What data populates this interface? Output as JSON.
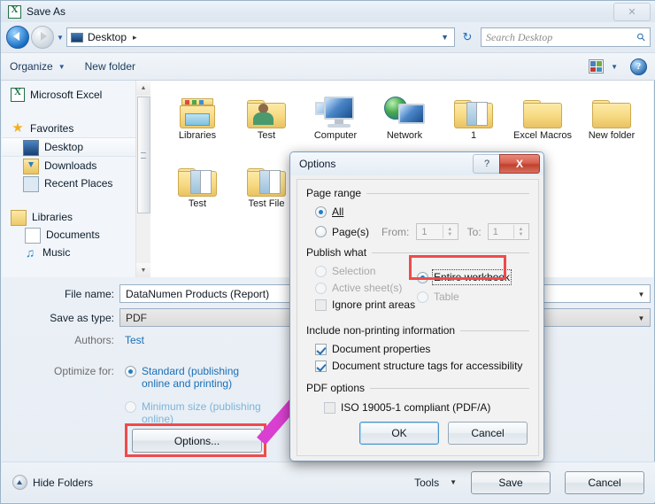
{
  "window": {
    "title": "Save As",
    "app_icon": "excel-icon",
    "close_label": "✕"
  },
  "address_bar": {
    "back_icon": "back-arrow-icon",
    "forward_icon": "forward-arrow-icon",
    "history_icon": "chevron-down-icon",
    "location_icon": "desktop-icon",
    "location": "Desktop",
    "separator": "▸",
    "dropdown_icon": "chevron-down-icon",
    "refresh_icon": "refresh-icon",
    "search_placeholder": "Search Desktop",
    "search_value": "",
    "search_icon": "magnifier-icon"
  },
  "command_bar": {
    "organize": "Organize",
    "new_folder": "New folder",
    "view_icon": "view-layout-icon",
    "view_dropdown_icon": "chevron-down-icon",
    "help_icon": "help-icon",
    "help_label": "?"
  },
  "nav_pane": {
    "items": [
      {
        "label": "Microsoft Excel",
        "icon": "excel-icon",
        "level": 1,
        "selected": false
      },
      {
        "label": "Favorites",
        "icon": "star-icon",
        "level": 1,
        "selected": false
      },
      {
        "label": "Desktop",
        "icon": "desktop-icon",
        "level": 2,
        "selected": true
      },
      {
        "label": "Downloads",
        "icon": "downloads-folder-icon",
        "level": 2,
        "selected": false
      },
      {
        "label": "Recent Places",
        "icon": "recent-places-icon",
        "level": 2,
        "selected": false
      },
      {
        "label": "Libraries",
        "icon": "libraries-icon",
        "level": 1,
        "selected": false
      },
      {
        "label": "Documents",
        "icon": "document-icon",
        "level": 2,
        "selected": false
      },
      {
        "label": "Music",
        "icon": "music-note-icon",
        "level": 2,
        "selected": false
      }
    ],
    "scroll_up_icon": "scroll-up-icon",
    "scroll_down_icon": "scroll-down-icon"
  },
  "file_pane": {
    "items": [
      {
        "label": "Libraries",
        "icon": "libraries-icon"
      },
      {
        "label": "Test",
        "icon": "user-folder-icon"
      },
      {
        "label": "Computer",
        "icon": "computer-icon"
      },
      {
        "label": "Network",
        "icon": "network-icon"
      },
      {
        "label": "1",
        "icon": "folder-with-files-icon"
      },
      {
        "label": "Excel Macros",
        "icon": "folder-icon"
      },
      {
        "label": "New folder",
        "icon": "folder-icon"
      },
      {
        "label": "Test",
        "icon": "folder-with-files-icon"
      },
      {
        "label": "Test File",
        "icon": "folder-with-files-icon"
      }
    ]
  },
  "form": {
    "file_name_label": "File name:",
    "file_name_value": "DataNumen Products (Report)",
    "save_as_type_label": "Save as type:",
    "save_as_type_value": "PDF",
    "authors_label": "Authors:",
    "authors_value": "Test",
    "optimize_label": "Optimize for:",
    "optimize_options": [
      {
        "label": "Standard (publishing online and printing)",
        "selected": true
      },
      {
        "label": "Minimum size (publishing online)",
        "selected": false
      }
    ],
    "options_button": "Options...",
    "dropdown_icon": "chevron-down-icon"
  },
  "footer": {
    "hide_folders": "Hide Folders",
    "hide_folders_icon": "collapse-icon",
    "tools": "Tools",
    "tools_dropdown_icon": "chevron-down-icon",
    "save": "Save",
    "cancel": "Cancel"
  },
  "dialog": {
    "title": "Options",
    "help_label": "?",
    "close_label": "X",
    "help_icon": "question-mark-icon",
    "close_icon": "close-icon",
    "page_range": {
      "title": "Page range",
      "all": "All",
      "pages": "Page(s)",
      "from_label": "From:",
      "from_value": "1",
      "to_label": "To:",
      "to_value": "1",
      "selected": "All",
      "spinner_up_icon": "spinner-up-icon",
      "spinner_down_icon": "spinner-down-icon"
    },
    "publish_what": {
      "title": "Publish what",
      "selection": "Selection",
      "active_sheets": "Active sheet(s)",
      "entire_workbook": "Entire workbook",
      "table": "Table",
      "ignore_print_areas": "Ignore print areas",
      "selected": "Entire workbook",
      "ignore_print_areas_checked": false
    },
    "non_printing": {
      "title": "Include non-printing information",
      "document_properties": "Document properties",
      "document_properties_checked": true,
      "structure_tags": "Document structure tags for accessibility",
      "structure_tags_checked": true
    },
    "pdf_options": {
      "title": "PDF options",
      "iso_compliant": "ISO 19005-1 compliant (PDF/A)",
      "iso_compliant_checked": false
    },
    "ok": "OK",
    "cancel": "Cancel"
  },
  "annotations": {
    "highlight_color": "#ef4b4b",
    "arrow_color": "#d93fd0",
    "accent_color": "#1a6fb5"
  }
}
